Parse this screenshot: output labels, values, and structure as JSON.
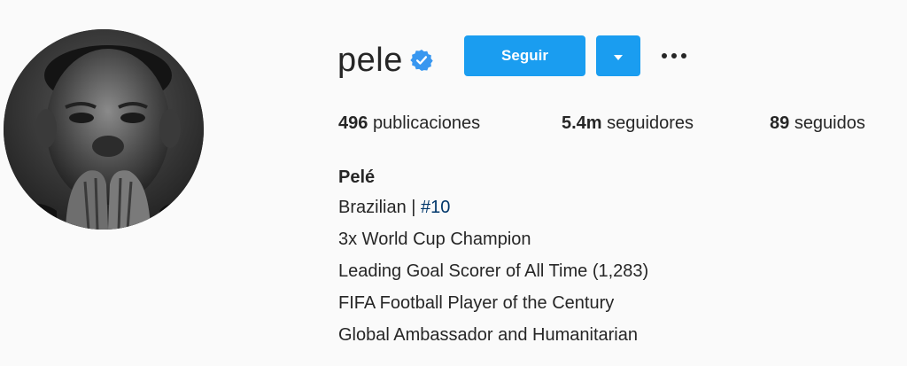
{
  "profile": {
    "username": "pele",
    "verified": true,
    "follow_label": "Seguir",
    "stats": {
      "posts_count": "496",
      "posts_label": "publicaciones",
      "followers_count": "5.4m",
      "followers_label": "seguidores",
      "following_count": "89",
      "following_label": "seguidos"
    },
    "bio": {
      "full_name": "Pelé",
      "line1_prefix": "Brazilian | ",
      "line1_hashtag": "#10",
      "line2": "3x World Cup Champion",
      "line3": "Leading Goal Scorer of All Time (1,283)",
      "line4": "FIFA Football Player of the Century",
      "line5": "Global Ambassador and Humanitarian"
    }
  },
  "colors": {
    "background": "#fafafa",
    "primary_button": "#1a9df0",
    "verified_badge": "#3897f0",
    "text": "#262626",
    "hashtag": "#00376b"
  },
  "icons": {
    "verified": "verified-badge-icon",
    "dropdown": "chevron-down-icon",
    "more": "more-options-icon"
  }
}
